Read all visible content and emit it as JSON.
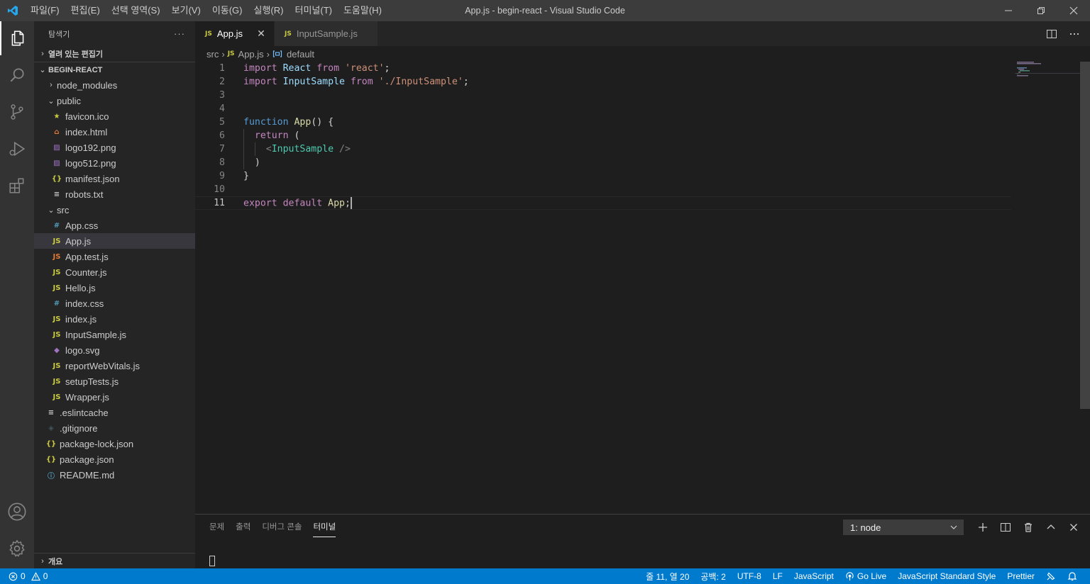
{
  "window": {
    "title": "App.js - begin-react - Visual Studio Code",
    "menu": [
      "파일(F)",
      "편집(E)",
      "선택 영역(S)",
      "보기(V)",
      "이동(G)",
      "실행(R)",
      "터미널(T)",
      "도움말(H)"
    ]
  },
  "activity_bar": {
    "items": [
      "files-icon",
      "search-icon",
      "source-control-icon",
      "run-debug-icon",
      "extensions-icon"
    ],
    "bottom": [
      "account-icon",
      "settings-gear-icon"
    ]
  },
  "sidebar": {
    "title": "탐색기",
    "more": "···",
    "open_editors": "열려 있는 편집기",
    "project": "BEGIN-REACT",
    "outline": "개요",
    "tree": [
      {
        "label": "node_modules",
        "kind": "folder-closed"
      },
      {
        "label": "public",
        "kind": "folder-open"
      },
      {
        "label": "favicon.ico",
        "kind": "star"
      },
      {
        "label": "index.html",
        "kind": "html"
      },
      {
        "label": "logo192.png",
        "kind": "image"
      },
      {
        "label": "logo512.png",
        "kind": "image"
      },
      {
        "label": "manifest.json",
        "kind": "json"
      },
      {
        "label": "robots.txt",
        "kind": "text"
      },
      {
        "label": "src",
        "kind": "folder-open"
      },
      {
        "label": "App.css",
        "kind": "css"
      },
      {
        "label": "App.js",
        "kind": "js"
      },
      {
        "label": "App.test.js",
        "kind": "js-test"
      },
      {
        "label": "Counter.js",
        "kind": "js"
      },
      {
        "label": "Hello.js",
        "kind": "js"
      },
      {
        "label": "index.css",
        "kind": "css"
      },
      {
        "label": "index.js",
        "kind": "js"
      },
      {
        "label": "InputSample.js",
        "kind": "js"
      },
      {
        "label": "logo.svg",
        "kind": "svg"
      },
      {
        "label": "reportWebVitals.js",
        "kind": "js"
      },
      {
        "label": "setupTests.js",
        "kind": "js"
      },
      {
        "label": "Wrapper.js",
        "kind": "js"
      },
      {
        "label": ".eslintcache",
        "kind": "text"
      },
      {
        "label": ".gitignore",
        "kind": "git"
      },
      {
        "label": "package-lock.json",
        "kind": "json"
      },
      {
        "label": "package.json",
        "kind": "json"
      },
      {
        "label": "README.md",
        "kind": "info"
      }
    ]
  },
  "tabs": [
    {
      "label": "App.js",
      "badge": "JS",
      "active": true,
      "close": "✕"
    },
    {
      "label": "InputSample.js",
      "badge": "JS",
      "active": false
    }
  ],
  "breadcrumb": {
    "folder": "src",
    "file": "App.js",
    "badge": "JS",
    "symbol": "default"
  },
  "editor": {
    "line_numbers": [
      "1",
      "2",
      "3",
      "4",
      "5",
      "6",
      "7",
      "8",
      "9",
      "10",
      "11"
    ],
    "current_line": "11",
    "lines": [
      "import React from 'react';",
      "import InputSample from './InputSample';",
      "",
      "",
      "function App() {",
      "  return (",
      "    <InputSample />",
      "  )",
      "}",
      "",
      "export default App;"
    ]
  },
  "panel": {
    "tabs": [
      "문제",
      "출력",
      "디버그 콘솔",
      "터미널"
    ],
    "active_tab": "터미널",
    "terminal_select": "1: node"
  },
  "status_bar": {
    "errors": "0",
    "warnings": "0",
    "position": "줄 11, 열 20",
    "spaces": "공백: 2",
    "encoding": "UTF-8",
    "eol": "LF",
    "language": "JavaScript",
    "go_live": "Go Live",
    "linter": "JavaScript Standard Style",
    "formatter": "Prettier"
  },
  "colors": {
    "accent": "#007acc",
    "js_badge": "#cbcb41",
    "keyword": "#c586c0",
    "string": "#ce9178",
    "component": "#4ec9b0"
  }
}
